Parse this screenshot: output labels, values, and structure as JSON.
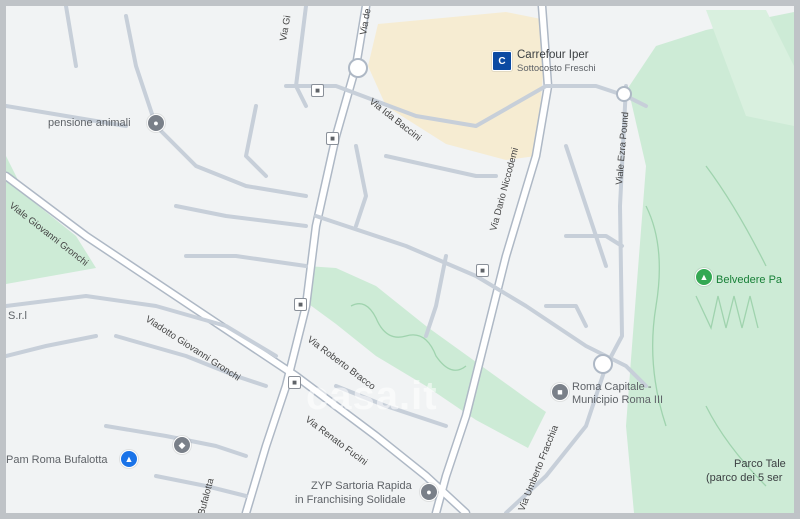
{
  "map": {
    "watermark": "casa.it",
    "colors": {
      "background": "#f1f3f4",
      "road": "#c7cfd9",
      "road_edge": "#aeb8c5",
      "park": "#cdebd6",
      "park_dark": "#b7e2c2",
      "commercial": "#f6ecd2"
    },
    "streets": {
      "via_gi": "Via Gi",
      "via_de": "Via de",
      "via_ida_baccini": "Via Ida Baccini",
      "via_dario_niccodemi": "Via Dario Niccodemi",
      "viale_ezra_pound": "Viale Ezra Pound",
      "viale_giovanni_gronchi": "Viale Giovanni Gronchi",
      "viadotto_giovanni_gronchi": "Viadotto Giovanni Gronchi",
      "via_roberto_bracco": "Via Roberto Bracco",
      "via_renato_fucini": "Via Renato Fucini",
      "via_umberto_fracchia": "Via Umberto Fracchia",
      "bufalotta": "Bufalotta"
    },
    "places": {
      "carrefour": {
        "title": "Carrefour Iper",
        "subtitle": "Sottocosto Freschi",
        "icon": "carrefour-logo-icon"
      },
      "pensione_animali": {
        "title": "pensione animali",
        "icon": "place-pin-icon"
      },
      "belvedere": {
        "title": "Belvedere Pa",
        "icon": "tree-icon"
      },
      "municipio": {
        "title_line1": "Roma Capitale -",
        "title_line2": "Municipio Roma III",
        "icon": "government-building-icon"
      },
      "pam": {
        "title": "Pam Roma Bufalotta",
        "icon": "shopping-cart-icon"
      },
      "zyp": {
        "title_line1": "ZYP Sartoria Rapida",
        "title_line2": "in Franchising Solidale",
        "icon": "place-pin-icon"
      },
      "parco": {
        "title_line1": "Parco Tale",
        "title_line2": "(parco dei 5 ser"
      },
      "srl": {
        "title": "S.r.l"
      },
      "school": {
        "icon": "school-icon"
      }
    }
  }
}
